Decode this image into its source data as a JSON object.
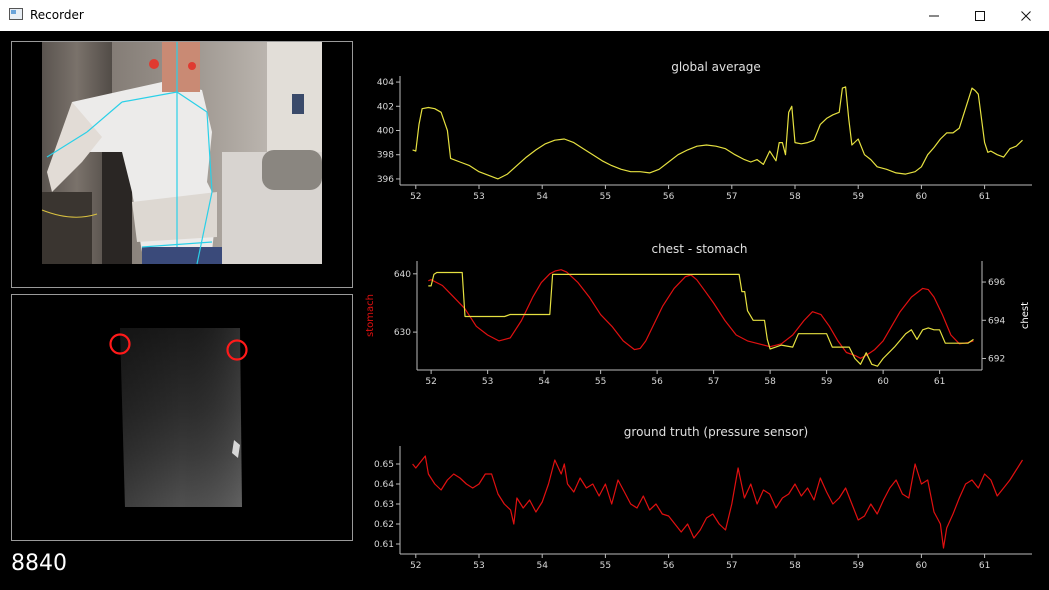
{
  "window": {
    "title": "Recorder",
    "minimize_label": "—",
    "maximize_label": "☐",
    "close_label": "✕"
  },
  "counter": "8840",
  "colors": {
    "global_line": "#e5e040",
    "stomach_line": "#e01010",
    "chest_line": "#e5e040",
    "ground_truth_line": "#e01010",
    "landmark_marker": "#ff1a1a",
    "skeleton": "#2ad0e8"
  },
  "icons": {
    "app": "app-window-icon",
    "minimize": "minimize-icon",
    "maximize": "maximize-icon",
    "close": "close-icon"
  },
  "chart_data": [
    {
      "type": "line",
      "title": "global average",
      "xlabel": "",
      "ylabel": "",
      "xlim": [
        51.75,
        61.75
      ],
      "ylim": [
        395.5,
        404.5
      ],
      "xticks": [
        "52",
        "53",
        "54",
        "55",
        "56",
        "57",
        "58",
        "59",
        "60",
        "61"
      ],
      "yticks": [
        "396",
        "398",
        "400",
        "402",
        "404"
      ],
      "grid": false,
      "series": [
        {
          "x": [
            51.95,
            52.0,
            52.05,
            52.1,
            52.2,
            52.3,
            52.4,
            52.5,
            52.55,
            52.7,
            52.85,
            53.0,
            53.15,
            53.3,
            53.45,
            53.6,
            53.75,
            53.9,
            54.05,
            54.2,
            54.35,
            54.5,
            54.65,
            54.8,
            54.95,
            55.1,
            55.25,
            55.4,
            55.55,
            55.7,
            55.85,
            56.0,
            56.15,
            56.3,
            56.45,
            56.6,
            56.75,
            56.9,
            57.05,
            57.2,
            57.3,
            57.4,
            57.5,
            57.6,
            57.7,
            57.75,
            57.8,
            57.85,
            57.9,
            57.95,
            58.0,
            58.1,
            58.2,
            58.3,
            58.4,
            58.5,
            58.6,
            58.7,
            58.75,
            58.8,
            58.85,
            58.9,
            59.0,
            59.1,
            59.2,
            59.3,
            59.45,
            59.6,
            59.75,
            59.9,
            60.0,
            60.1,
            60.2,
            60.3,
            60.4,
            60.5,
            60.6,
            60.8,
            60.85,
            60.9,
            61.0,
            61.05,
            61.1,
            61.2,
            61.3,
            61.4,
            61.5,
            61.6
          ],
          "y": [
            398.4,
            398.3,
            400.5,
            401.8,
            401.9,
            401.8,
            401.5,
            400.0,
            397.7,
            397.4,
            397.1,
            396.6,
            396.3,
            396.0,
            396.4,
            397.1,
            397.8,
            398.4,
            398.9,
            399.2,
            399.3,
            399.0,
            398.5,
            398.0,
            397.5,
            397.1,
            396.8,
            396.6,
            396.6,
            396.5,
            396.8,
            397.4,
            398.0,
            398.4,
            398.7,
            398.8,
            398.7,
            398.5,
            398.0,
            397.6,
            397.4,
            397.6,
            397.2,
            398.3,
            397.5,
            399.0,
            399.0,
            398.0,
            401.5,
            402.0,
            399.0,
            398.9,
            399.0,
            399.2,
            400.5,
            401.0,
            401.3,
            401.5,
            403.5,
            403.6,
            401.0,
            398.8,
            399.3,
            398.0,
            397.6,
            397.0,
            396.8,
            396.5,
            396.4,
            396.6,
            397.0,
            398.0,
            398.6,
            399.3,
            399.8,
            399.8,
            400.2,
            403.5,
            403.3,
            403.0,
            399.0,
            398.2,
            398.3,
            398.0,
            397.8,
            398.5,
            398.7,
            399.2
          ]
        }
      ]
    },
    {
      "type": "line",
      "title": "chest - stomach",
      "xlabel": "",
      "ylabel": "stomach",
      "y2label": "chest",
      "xlim": [
        51.75,
        61.75
      ],
      "ylim": [
        623.5,
        642.2
      ],
      "y2lim": [
        691.4,
        697.1
      ],
      "xticks": [
        "52",
        "53",
        "54",
        "55",
        "56",
        "57",
        "58",
        "59",
        "60",
        "61"
      ],
      "yticks": [
        "630",
        "640"
      ],
      "y2ticks": [
        "692",
        "694",
        "696"
      ],
      "grid": false,
      "series": [
        {
          "name": "stomach",
          "x": [
            51.95,
            52.0,
            52.2,
            52.4,
            52.6,
            52.8,
            53.0,
            53.2,
            53.4,
            53.6,
            53.8,
            53.95,
            54.1,
            54.2,
            54.3,
            54.4,
            54.6,
            54.8,
            55.0,
            55.2,
            55.4,
            55.6,
            55.7,
            55.8,
            55.95,
            56.1,
            56.3,
            56.5,
            56.6,
            56.7,
            56.85,
            57.0,
            57.2,
            57.4,
            57.6,
            57.8,
            58.0,
            58.2,
            58.4,
            58.6,
            58.75,
            58.9,
            59.05,
            59.2,
            59.35,
            59.5,
            59.6,
            59.7,
            59.85,
            60.0,
            60.15,
            60.3,
            60.5,
            60.7,
            60.8,
            60.9,
            61.05,
            61.2,
            61.35,
            61.5,
            61.6
          ],
          "y": [
            638.8,
            639.0,
            638.0,
            636.0,
            634.0,
            631.0,
            629.5,
            628.5,
            629.0,
            632.0,
            636.0,
            638.5,
            640.0,
            640.5,
            640.7,
            640.3,
            638.5,
            636.0,
            633.0,
            631.0,
            628.5,
            627.0,
            627.2,
            628.5,
            631.5,
            634.5,
            637.5,
            639.5,
            639.8,
            639.0,
            637.0,
            635.0,
            632.0,
            629.5,
            628.5,
            628.0,
            627.5,
            628.0,
            629.5,
            632.0,
            633.5,
            633.0,
            631.0,
            628.5,
            626.5,
            626.0,
            625.5,
            626.0,
            627.0,
            628.5,
            631.0,
            633.5,
            636.0,
            637.5,
            637.3,
            636.0,
            633.0,
            629.5,
            628.0,
            628.2,
            628.5
          ]
        },
        {
          "name": "chest",
          "axis": "right",
          "x": [
            51.95,
            52.0,
            52.05,
            52.1,
            52.2,
            52.4,
            52.55,
            52.6,
            53.0,
            53.3,
            53.4,
            53.8,
            54.1,
            54.15,
            55.0,
            56.0,
            57.0,
            57.45,
            57.5,
            57.55,
            57.6,
            57.7,
            57.9,
            57.95,
            58.0,
            58.1,
            58.2,
            58.4,
            58.5,
            58.8,
            59.0,
            59.1,
            59.2,
            59.4,
            59.5,
            59.6,
            59.7,
            59.8,
            59.9,
            60.0,
            60.2,
            60.4,
            60.5,
            60.6,
            60.7,
            60.8,
            60.9,
            61.0,
            61.1,
            61.2,
            61.3,
            61.5,
            61.6
          ],
          "y": [
            695.8,
            695.8,
            696.4,
            696.5,
            696.5,
            696.5,
            696.5,
            694.2,
            694.2,
            694.2,
            694.3,
            694.3,
            694.3,
            696.4,
            696.4,
            696.4,
            696.4,
            696.4,
            695.5,
            695.5,
            694.5,
            694.0,
            694.0,
            693.0,
            692.5,
            692.6,
            692.7,
            692.6,
            693.3,
            693.3,
            693.3,
            692.6,
            692.6,
            692.6,
            692.0,
            691.7,
            692.3,
            691.7,
            691.6,
            692.0,
            692.6,
            693.3,
            693.5,
            693.0,
            693.5,
            693.6,
            693.5,
            693.5,
            692.8,
            692.8,
            692.8,
            692.8,
            693.0
          ]
        }
      ]
    },
    {
      "type": "line",
      "title": "ground truth (pressure sensor)",
      "xlabel": "",
      "ylabel": "",
      "xlim": [
        51.75,
        61.75
      ],
      "ylim": [
        0.605,
        0.659
      ],
      "xticks": [
        "52",
        "53",
        "54",
        "55",
        "56",
        "57",
        "58",
        "59",
        "60",
        "61"
      ],
      "yticks": [
        "0.61",
        "0.62",
        "0.63",
        "0.64",
        "0.65"
      ],
      "grid": false,
      "series": [
        {
          "x": [
            51.95,
            52.0,
            52.1,
            52.15,
            52.2,
            52.3,
            52.4,
            52.5,
            52.6,
            52.7,
            52.8,
            52.9,
            53.0,
            53.1,
            53.2,
            53.3,
            53.4,
            53.5,
            53.55,
            53.6,
            53.7,
            53.8,
            53.9,
            54.0,
            54.1,
            54.2,
            54.3,
            54.35,
            54.4,
            54.5,
            54.6,
            54.7,
            54.8,
            54.9,
            55.0,
            55.1,
            55.2,
            55.3,
            55.4,
            55.5,
            55.6,
            55.7,
            55.8,
            55.9,
            56.0,
            56.1,
            56.2,
            56.3,
            56.4,
            56.5,
            56.6,
            56.7,
            56.8,
            56.9,
            57.0,
            57.1,
            57.2,
            57.3,
            57.4,
            57.5,
            57.6,
            57.7,
            57.8,
            57.9,
            58.0,
            58.1,
            58.2,
            58.3,
            58.4,
            58.5,
            58.6,
            58.7,
            58.8,
            58.9,
            59.0,
            59.1,
            59.2,
            59.3,
            59.4,
            59.5,
            59.6,
            59.7,
            59.8,
            59.9,
            60.0,
            60.1,
            60.2,
            60.3,
            60.35,
            60.4,
            60.5,
            60.6,
            60.7,
            60.8,
            60.9,
            61.0,
            61.1,
            61.2,
            61.3,
            61.4,
            61.5,
            61.6
          ],
          "y": [
            0.65,
            0.648,
            0.652,
            0.654,
            0.645,
            0.64,
            0.637,
            0.642,
            0.645,
            0.643,
            0.64,
            0.638,
            0.64,
            0.645,
            0.645,
            0.635,
            0.63,
            0.627,
            0.62,
            0.633,
            0.628,
            0.632,
            0.626,
            0.631,
            0.64,
            0.652,
            0.645,
            0.65,
            0.64,
            0.636,
            0.643,
            0.638,
            0.64,
            0.634,
            0.64,
            0.63,
            0.642,
            0.636,
            0.63,
            0.628,
            0.634,
            0.627,
            0.63,
            0.625,
            0.624,
            0.62,
            0.616,
            0.62,
            0.613,
            0.617,
            0.623,
            0.625,
            0.62,
            0.617,
            0.63,
            0.648,
            0.633,
            0.64,
            0.63,
            0.637,
            0.635,
            0.628,
            0.633,
            0.635,
            0.64,
            0.634,
            0.638,
            0.632,
            0.643,
            0.636,
            0.63,
            0.633,
            0.638,
            0.63,
            0.622,
            0.624,
            0.63,
            0.625,
            0.632,
            0.638,
            0.642,
            0.635,
            0.633,
            0.65,
            0.64,
            0.642,
            0.626,
            0.62,
            0.608,
            0.618,
            0.625,
            0.633,
            0.64,
            0.642,
            0.638,
            0.645,
            0.642,
            0.634,
            0.638,
            0.642,
            0.647,
            0.652
          ]
        }
      ]
    }
  ]
}
